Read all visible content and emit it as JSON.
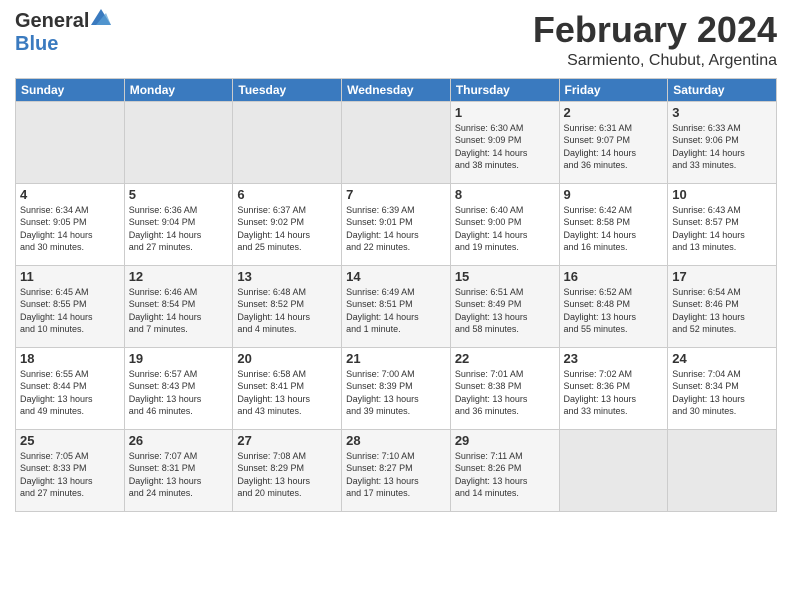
{
  "logo": {
    "general": "General",
    "blue": "Blue"
  },
  "title": {
    "month": "February 2024",
    "location": "Sarmiento, Chubut, Argentina"
  },
  "headers": [
    "Sunday",
    "Monday",
    "Tuesday",
    "Wednesday",
    "Thursday",
    "Friday",
    "Saturday"
  ],
  "weeks": [
    [
      {
        "day": "",
        "info": ""
      },
      {
        "day": "",
        "info": ""
      },
      {
        "day": "",
        "info": ""
      },
      {
        "day": "",
        "info": ""
      },
      {
        "day": "1",
        "info": "Sunrise: 6:30 AM\nSunset: 9:09 PM\nDaylight: 14 hours\nand 38 minutes."
      },
      {
        "day": "2",
        "info": "Sunrise: 6:31 AM\nSunset: 9:07 PM\nDaylight: 14 hours\nand 36 minutes."
      },
      {
        "day": "3",
        "info": "Sunrise: 6:33 AM\nSunset: 9:06 PM\nDaylight: 14 hours\nand 33 minutes."
      }
    ],
    [
      {
        "day": "4",
        "info": "Sunrise: 6:34 AM\nSunset: 9:05 PM\nDaylight: 14 hours\nand 30 minutes."
      },
      {
        "day": "5",
        "info": "Sunrise: 6:36 AM\nSunset: 9:04 PM\nDaylight: 14 hours\nand 27 minutes."
      },
      {
        "day": "6",
        "info": "Sunrise: 6:37 AM\nSunset: 9:02 PM\nDaylight: 14 hours\nand 25 minutes."
      },
      {
        "day": "7",
        "info": "Sunrise: 6:39 AM\nSunset: 9:01 PM\nDaylight: 14 hours\nand 22 minutes."
      },
      {
        "day": "8",
        "info": "Sunrise: 6:40 AM\nSunset: 9:00 PM\nDaylight: 14 hours\nand 19 minutes."
      },
      {
        "day": "9",
        "info": "Sunrise: 6:42 AM\nSunset: 8:58 PM\nDaylight: 14 hours\nand 16 minutes."
      },
      {
        "day": "10",
        "info": "Sunrise: 6:43 AM\nSunset: 8:57 PM\nDaylight: 14 hours\nand 13 minutes."
      }
    ],
    [
      {
        "day": "11",
        "info": "Sunrise: 6:45 AM\nSunset: 8:55 PM\nDaylight: 14 hours\nand 10 minutes."
      },
      {
        "day": "12",
        "info": "Sunrise: 6:46 AM\nSunset: 8:54 PM\nDaylight: 14 hours\nand 7 minutes."
      },
      {
        "day": "13",
        "info": "Sunrise: 6:48 AM\nSunset: 8:52 PM\nDaylight: 14 hours\nand 4 minutes."
      },
      {
        "day": "14",
        "info": "Sunrise: 6:49 AM\nSunset: 8:51 PM\nDaylight: 14 hours\nand 1 minute."
      },
      {
        "day": "15",
        "info": "Sunrise: 6:51 AM\nSunset: 8:49 PM\nDaylight: 13 hours\nand 58 minutes."
      },
      {
        "day": "16",
        "info": "Sunrise: 6:52 AM\nSunset: 8:48 PM\nDaylight: 13 hours\nand 55 minutes."
      },
      {
        "day": "17",
        "info": "Sunrise: 6:54 AM\nSunset: 8:46 PM\nDaylight: 13 hours\nand 52 minutes."
      }
    ],
    [
      {
        "day": "18",
        "info": "Sunrise: 6:55 AM\nSunset: 8:44 PM\nDaylight: 13 hours\nand 49 minutes."
      },
      {
        "day": "19",
        "info": "Sunrise: 6:57 AM\nSunset: 8:43 PM\nDaylight: 13 hours\nand 46 minutes."
      },
      {
        "day": "20",
        "info": "Sunrise: 6:58 AM\nSunset: 8:41 PM\nDaylight: 13 hours\nand 43 minutes."
      },
      {
        "day": "21",
        "info": "Sunrise: 7:00 AM\nSunset: 8:39 PM\nDaylight: 13 hours\nand 39 minutes."
      },
      {
        "day": "22",
        "info": "Sunrise: 7:01 AM\nSunset: 8:38 PM\nDaylight: 13 hours\nand 36 minutes."
      },
      {
        "day": "23",
        "info": "Sunrise: 7:02 AM\nSunset: 8:36 PM\nDaylight: 13 hours\nand 33 minutes."
      },
      {
        "day": "24",
        "info": "Sunrise: 7:04 AM\nSunset: 8:34 PM\nDaylight: 13 hours\nand 30 minutes."
      }
    ],
    [
      {
        "day": "25",
        "info": "Sunrise: 7:05 AM\nSunset: 8:33 PM\nDaylight: 13 hours\nand 27 minutes."
      },
      {
        "day": "26",
        "info": "Sunrise: 7:07 AM\nSunset: 8:31 PM\nDaylight: 13 hours\nand 24 minutes."
      },
      {
        "day": "27",
        "info": "Sunrise: 7:08 AM\nSunset: 8:29 PM\nDaylight: 13 hours\nand 20 minutes."
      },
      {
        "day": "28",
        "info": "Sunrise: 7:10 AM\nSunset: 8:27 PM\nDaylight: 13 hours\nand 17 minutes."
      },
      {
        "day": "29",
        "info": "Sunrise: 7:11 AM\nSunset: 8:26 PM\nDaylight: 13 hours\nand 14 minutes."
      },
      {
        "day": "",
        "info": ""
      },
      {
        "day": "",
        "info": ""
      }
    ]
  ]
}
